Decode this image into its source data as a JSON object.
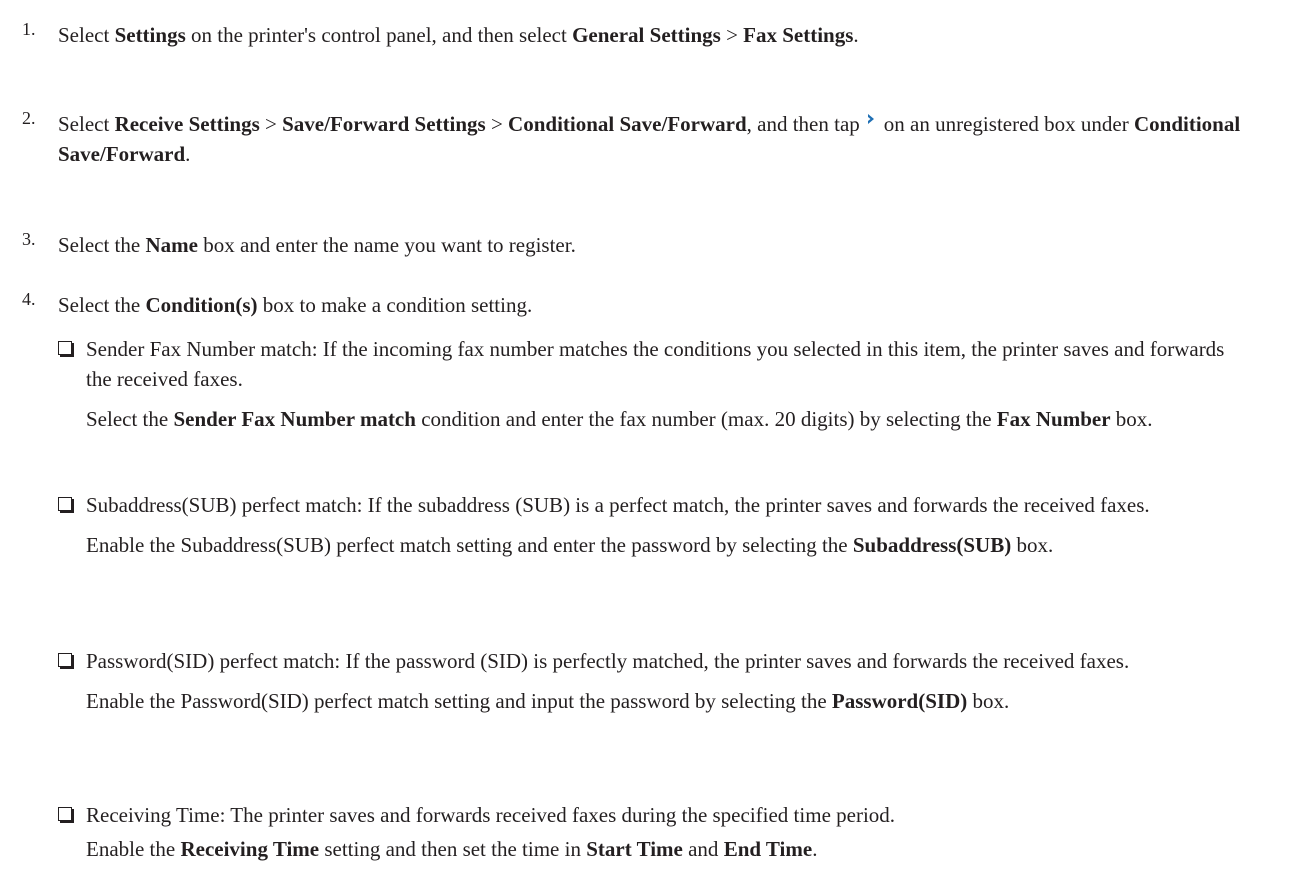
{
  "steps": [
    {
      "num": "1.",
      "parts": [
        {
          "t": "Select "
        },
        {
          "b": "Settings"
        },
        {
          "t": " on the printer's control panel, and then select "
        },
        {
          "b": "General Settings"
        },
        {
          "t": " > "
        },
        {
          "b": "Fax Settings"
        },
        {
          "t": "."
        }
      ]
    },
    {
      "num": "2.",
      "parts": [
        {
          "t": "Select "
        },
        {
          "b": "Receive Settings"
        },
        {
          "t": " > "
        },
        {
          "b": "Save/Forward Settings"
        },
        {
          "t": " > "
        },
        {
          "b": "Conditional Save/Forward"
        },
        {
          "t": ", and then tap"
        },
        {
          "icon": "chevron-right-icon"
        },
        {
          "t": "on an unregistered box under "
        },
        {
          "b": "Conditional Save/Forward"
        },
        {
          "t": "."
        }
      ]
    },
    {
      "num": "3.",
      "parts": [
        {
          "t": "Select the "
        },
        {
          "b": "Name"
        },
        {
          "t": " box and enter the name you want to register."
        }
      ]
    },
    {
      "num": "4.",
      "parts": [
        {
          "t": "Select the "
        },
        {
          "b": "Condition(s)"
        },
        {
          "t": " box to make a condition setting."
        }
      ]
    }
  ],
  "options": [
    {
      "lead": [
        {
          "t": "Sender Fax Number match: If the incoming fax number matches the conditions you selected in this item, the printer saves and forwards the received faxes."
        }
      ],
      "detail": [
        {
          "t": "Select the "
        },
        {
          "b": "Sender Fax Number match"
        },
        {
          "t": " condition and enter the fax number (max. 20 digits) by selecting the "
        },
        {
          "b": "Fax Number"
        },
        {
          "t": " box."
        }
      ]
    },
    {
      "lead": [
        {
          "t": "Subaddress(SUB) perfect match: If the subaddress (SUB) is a perfect match, the printer saves and forwards the received faxes."
        }
      ],
      "detail": [
        {
          "t": "Enable the Subaddress(SUB) perfect match setting and enter the password by selecting the "
        },
        {
          "b": "Subaddress(SUB)"
        },
        {
          "t": " box."
        }
      ]
    },
    {
      "lead": [
        {
          "t": "Password(SID) perfect match: If the password (SID) is perfectly matched, the printer saves and forwards the received faxes."
        }
      ],
      "detail": [
        {
          "t": "Enable the Password(SID) perfect match setting and input the password by selecting the "
        },
        {
          "b": "Password(SID)"
        },
        {
          "t": " box."
        }
      ]
    },
    {
      "lead": [
        {
          "t": "Receiving Time: The printer saves and forwards received faxes during the specified time period."
        }
      ],
      "detail": [
        {
          "t": "Enable the "
        },
        {
          "b": "Receiving Time"
        },
        {
          "t": " setting and then set the time in "
        },
        {
          "b": "Start Time"
        },
        {
          "t": " and "
        },
        {
          "b": "End Time"
        },
        {
          "t": "."
        }
      ]
    }
  ],
  "colors": {
    "text": "#231f20",
    "icon": "#1f6fb4"
  }
}
